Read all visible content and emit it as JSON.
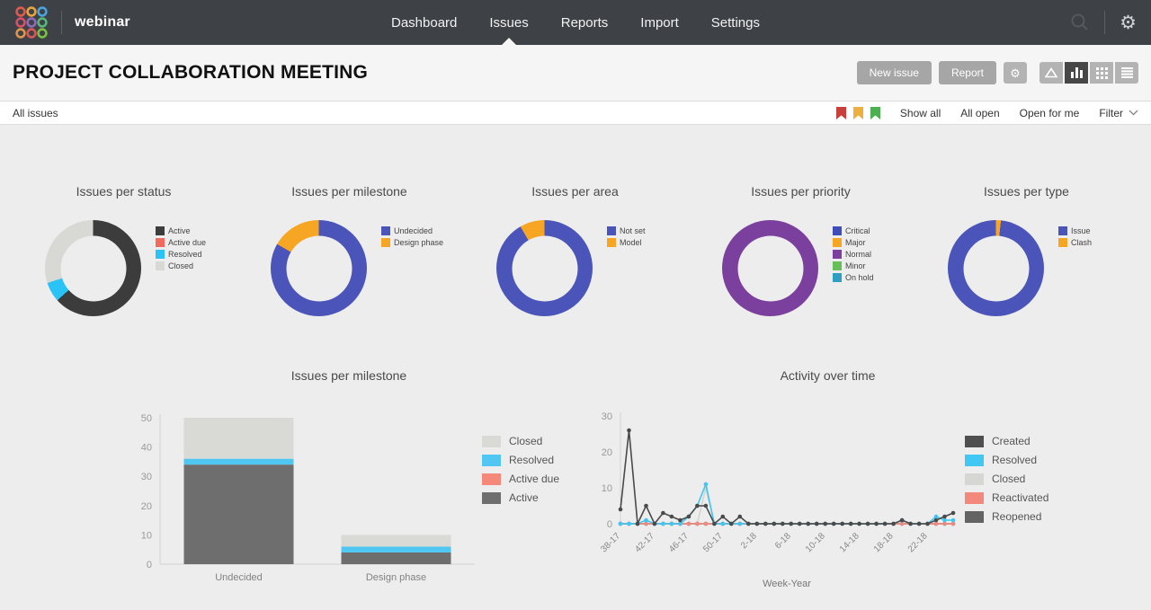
{
  "nav": {
    "brand": "webinar",
    "items": [
      {
        "label": "Dashboard",
        "active": false
      },
      {
        "label": "Issues",
        "active": true
      },
      {
        "label": "Reports",
        "active": false
      },
      {
        "label": "Import",
        "active": false
      },
      {
        "label": "Settings",
        "active": false
      }
    ]
  },
  "header": {
    "title": "PROJECT COLLABORATION MEETING",
    "new_issue_label": "New issue",
    "report_label": "Report",
    "view_toggles": [
      "triangle-view",
      "chart-view",
      "grid-view",
      "list-view"
    ],
    "active_view": "chart-view"
  },
  "filter_bar": {
    "current_filter": "All issues",
    "flag_colors": [
      "#c9403a",
      "#efaf3c",
      "#4caf50"
    ],
    "links": [
      "Show all",
      "All open",
      "Open for me"
    ],
    "filter_label": "Filter"
  },
  "colors": {
    "nav_bg": "#3e4246",
    "accent_blue": "#4b55b9",
    "accent_orange": "#f6a623",
    "accent_purple": "#7b3f9d",
    "dark_gray": "#3c3c3c",
    "cyan": "#29c4f5",
    "light_gray": "#d8d8d4",
    "salmon": "#f4695e"
  },
  "chart_data": [
    {
      "type": "pie",
      "title": "Issues per status",
      "donut": true,
      "slices": [
        {
          "label": "Active",
          "value": 38,
          "color": "#3c3c3c"
        },
        {
          "label": "Resolved",
          "value": 4,
          "color": "#29c4f5"
        },
        {
          "label": "Closed",
          "value": 18,
          "color": "#d8d8d4"
        }
      ],
      "legend": [
        {
          "label": "Active",
          "color": "#3c3c3c"
        },
        {
          "label": "Active due",
          "color": "#f4695e"
        },
        {
          "label": "Resolved",
          "color": "#29c4f5"
        },
        {
          "label": "Closed",
          "color": "#d8d8d4"
        }
      ]
    },
    {
      "type": "pie",
      "title": "Issues per milestone",
      "donut": true,
      "slices": [
        {
          "label": "Undecided",
          "value": 50,
          "color": "#4b55b9"
        },
        {
          "label": "Design phase",
          "value": 10,
          "color": "#f6a623"
        }
      ],
      "legend": [
        {
          "label": "Undecided",
          "color": "#4b55b9"
        },
        {
          "label": "Design phase",
          "color": "#f6a623"
        }
      ]
    },
    {
      "type": "pie",
      "title": "Issues per area",
      "donut": true,
      "slices": [
        {
          "label": "Not set",
          "value": 55,
          "color": "#4b55b9"
        },
        {
          "label": "Model",
          "value": 5,
          "color": "#f6a623"
        }
      ],
      "legend": [
        {
          "label": "Not set",
          "color": "#4b55b9"
        },
        {
          "label": "Model",
          "color": "#f6a623"
        }
      ]
    },
    {
      "type": "pie",
      "title": "Issues per priority",
      "donut": true,
      "slices": [
        {
          "label": "Normal",
          "value": 60,
          "color": "#7b3f9d"
        }
      ],
      "legend": [
        {
          "label": "Critical",
          "color": "#3e4db8"
        },
        {
          "label": "Major",
          "color": "#f6a623"
        },
        {
          "label": "Normal",
          "color": "#7b3f9d"
        },
        {
          "label": "Minor",
          "color": "#67bf5a"
        },
        {
          "label": "On hold",
          "color": "#2e9fc0"
        }
      ]
    },
    {
      "type": "pie",
      "title": "Issues per type",
      "donut": true,
      "slices": [
        {
          "label": "Clash",
          "value": 1,
          "color": "#f6a623"
        },
        {
          "label": "Issue",
          "value": 59,
          "color": "#4b55b9"
        }
      ],
      "legend": [
        {
          "label": "Issue",
          "color": "#4b55b9"
        },
        {
          "label": "Clash",
          "color": "#f6a623"
        }
      ]
    },
    {
      "type": "bar",
      "stacked": true,
      "title": "Issues per milestone",
      "categories": [
        "Undecided",
        "Design phase"
      ],
      "ylim": [
        0,
        50
      ],
      "yticks": [
        0,
        10,
        20,
        30,
        40,
        50
      ],
      "series": [
        {
          "name": "Active",
          "color": "#6e6e6e",
          "values": [
            34,
            4
          ]
        },
        {
          "name": "Active due",
          "color": "#f4887b",
          "values": [
            0,
            0
          ]
        },
        {
          "name": "Resolved",
          "color": "#4fc7f2",
          "values": [
            2,
            2
          ]
        },
        {
          "name": "Closed",
          "color": "#d9d9d6",
          "values": [
            14,
            4
          ]
        }
      ],
      "legend": [
        {
          "label": "Closed",
          "color": "#d9d9d6"
        },
        {
          "label": "Resolved",
          "color": "#4fc7f2"
        },
        {
          "label": "Active due",
          "color": "#f4887b"
        },
        {
          "label": "Active",
          "color": "#6e6e6e"
        }
      ]
    },
    {
      "type": "line",
      "title": "Activity over time",
      "xlabel": "Week-Year",
      "ylim": [
        0,
        30
      ],
      "yticks": [
        0,
        10,
        20,
        30
      ],
      "x": [
        "38-17",
        "39-17",
        "40-17",
        "41-17",
        "42-17",
        "43-17",
        "44-17",
        "45-17",
        "46-17",
        "47-17",
        "48-17",
        "49-17",
        "50-17",
        "51-17",
        "52-17",
        "1-18",
        "2-18",
        "3-18",
        "4-18",
        "5-18",
        "6-18",
        "7-18",
        "8-18",
        "9-18",
        "10-18",
        "11-18",
        "12-18",
        "13-18",
        "14-18",
        "15-18",
        "16-18",
        "17-18",
        "18-18",
        "19-18",
        "20-18",
        "21-18",
        "22-18",
        "23-18",
        "24-18",
        "25-18"
      ],
      "x_ticks_shown": [
        "38-17",
        "42-17",
        "46-17",
        "50-17",
        "2-18",
        "6-18",
        "10-18",
        "14-18",
        "18-18",
        "22-18"
      ],
      "series": [
        {
          "name": "Closed",
          "color": "#d4d4d1",
          "values": [
            0,
            0,
            0,
            0,
            0,
            0,
            0,
            0,
            0,
            0,
            10,
            0,
            0,
            0,
            0,
            0,
            0,
            0,
            0,
            0,
            0,
            0,
            0,
            0,
            0,
            0,
            0,
            0,
            0,
            0,
            0,
            0,
            0,
            0,
            0,
            0,
            0,
            0,
            0,
            0
          ]
        },
        {
          "name": "Reopened",
          "color": "#666666",
          "values": [
            0,
            0,
            0,
            0,
            0,
            0,
            0,
            0,
            0,
            0,
            0,
            0,
            0,
            0,
            0,
            0,
            0,
            0,
            0,
            0,
            0,
            0,
            0,
            0,
            0,
            0,
            0,
            0,
            0,
            0,
            0,
            0,
            0,
            0,
            0,
            0,
            0,
            0,
            0,
            0
          ]
        },
        {
          "name": "Reactivated",
          "color": "#f0897d",
          "values": [
            0,
            0,
            0,
            0,
            0,
            0,
            0,
            0,
            0,
            0,
            0,
            0,
            0,
            0,
            0,
            0,
            0,
            0,
            0,
            0,
            0,
            0,
            0,
            0,
            0,
            0,
            0,
            0,
            0,
            0,
            0,
            0,
            0,
            0,
            0,
            0,
            0,
            0,
            0,
            0
          ]
        },
        {
          "name": "Resolved",
          "color": "#3fc6f3",
          "values": [
            0,
            0,
            0,
            1,
            0,
            0,
            0,
            0,
            2,
            5,
            11,
            0,
            0,
            0,
            0,
            0,
            0,
            0,
            0,
            0,
            0,
            0,
            0,
            0,
            0,
            0,
            0,
            0,
            0,
            0,
            0,
            0,
            0,
            1,
            0,
            0,
            0,
            2,
            1,
            1
          ]
        },
        {
          "name": "Created",
          "color": "#4a4a4a",
          "values": [
            4,
            26,
            0,
            5,
            0,
            3,
            2,
            1,
            2,
            5,
            5,
            0,
            2,
            0,
            2,
            0,
            0,
            0,
            0,
            0,
            0,
            0,
            0,
            0,
            0,
            0,
            0,
            0,
            0,
            0,
            0,
            0,
            0,
            1,
            0,
            0,
            0,
            1,
            2,
            3
          ]
        }
      ],
      "legend": [
        {
          "label": "Created",
          "color": "#4f4f4f"
        },
        {
          "label": "Resolved",
          "color": "#41c7f4"
        },
        {
          "label": "Closed",
          "color": "#d6d6d3"
        },
        {
          "label": "Reactivated",
          "color": "#f2897c"
        },
        {
          "label": "Reopened",
          "color": "#636363"
        }
      ]
    }
  ]
}
